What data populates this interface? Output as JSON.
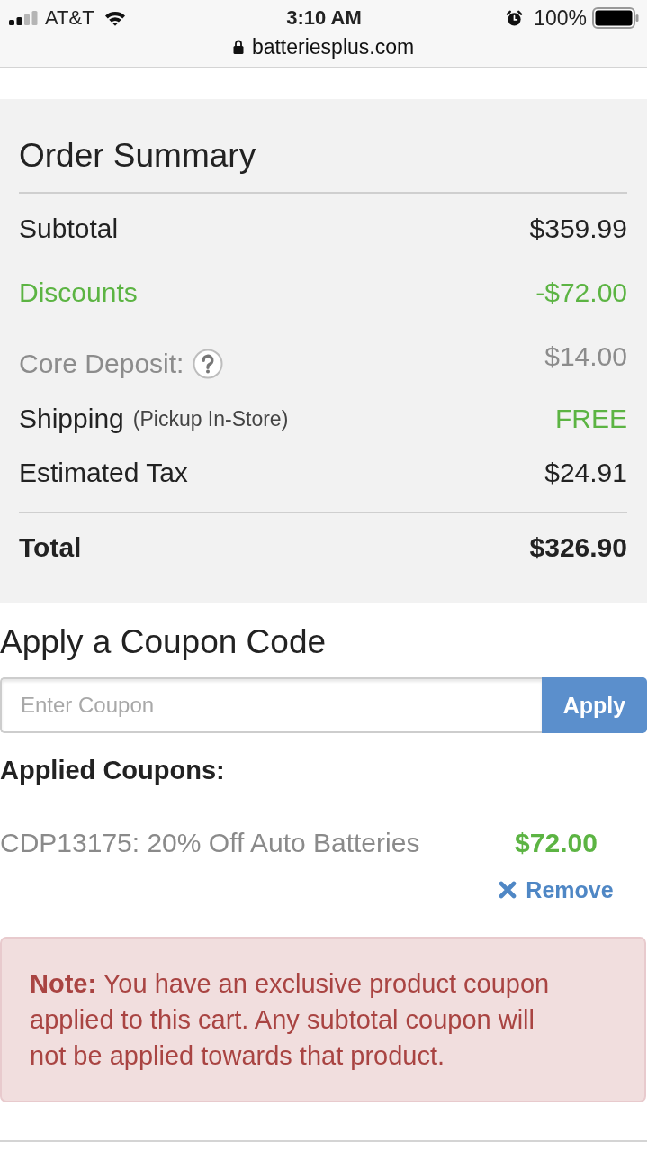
{
  "status_bar": {
    "carrier": "AT&T",
    "time": "3:10 AM",
    "battery": "100%"
  },
  "address_bar": {
    "url": "batteriesplus.com"
  },
  "order_summary": {
    "title": "Order Summary",
    "rows": [
      {
        "kind": "line",
        "label": "Subtotal",
        "value": "$359.99"
      },
      {
        "kind": "discount",
        "label": "Discounts",
        "value": "-$72.00"
      },
      {
        "kind": "deposit",
        "label": "Core Deposit:",
        "value": "$14.00"
      },
      {
        "kind": "shipping",
        "label": "Shipping",
        "note": "(Pickup In-Store)",
        "value": "FREE"
      },
      {
        "kind": "line",
        "label": "Estimated Tax",
        "value": "$24.91"
      }
    ],
    "total": {
      "label": "Total",
      "value": "$326.90"
    }
  },
  "coupon": {
    "title": "Apply a Coupon Code",
    "input": {
      "placeholder": "Enter Coupon"
    },
    "button": "Apply"
  },
  "applied_coupons": {
    "title": "Applied Coupons:",
    "items": [
      {
        "description": "CDP13175: 20% Off Auto Batteries",
        "amount": "$72.00",
        "remove": "Remove"
      }
    ]
  },
  "note": {
    "text": "**Note:** You have an exclusive product coupon applied to this cart. Any subtotal coupon will not be applied towards that product."
  }
}
